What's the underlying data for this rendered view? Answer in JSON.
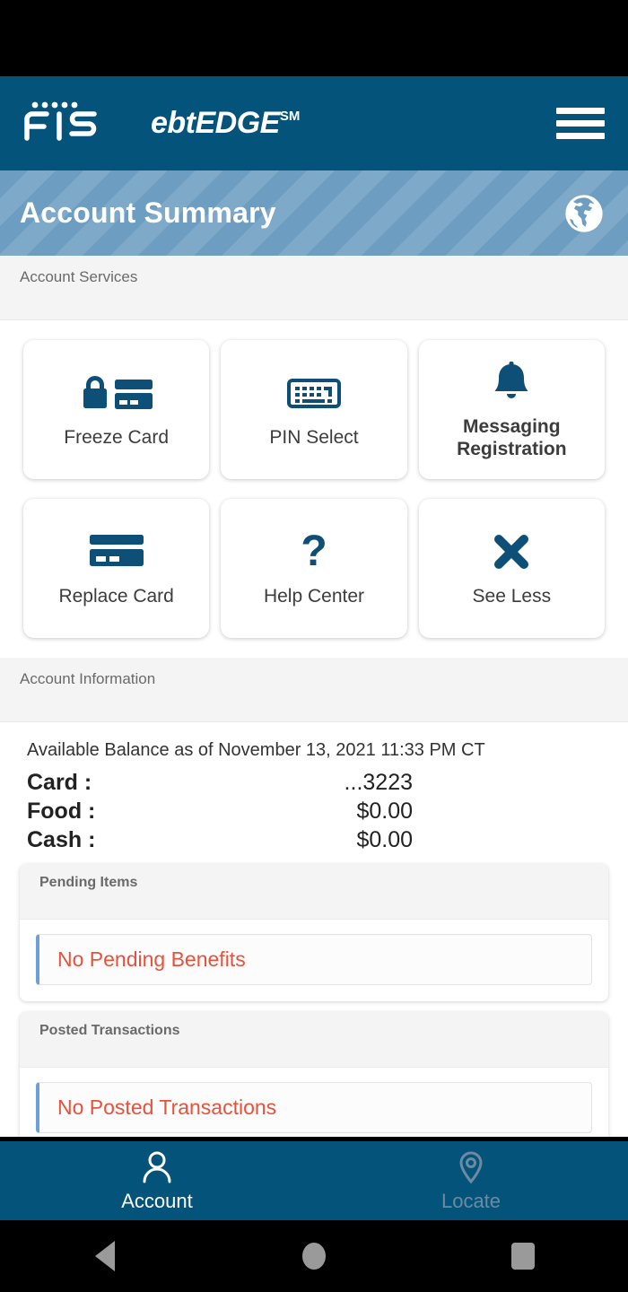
{
  "header": {
    "brand_fis": "FIS",
    "brand_product": "ebtEDGE",
    "brand_sm": "SM",
    "menu_icon": "hamburger-menu-icon"
  },
  "title_bar": {
    "title": "Account Summary",
    "globe_icon": "globe-icon"
  },
  "sections": {
    "account_services_label": "Account Services",
    "account_information_label": "Account Information"
  },
  "tiles": [
    {
      "label": "Freeze Card",
      "icon": "lock-card-icon"
    },
    {
      "label": "PIN Select",
      "icon": "keyboard-icon"
    },
    {
      "label": "Messaging Registration",
      "icon": "bell-icon"
    },
    {
      "label": "Replace Card",
      "icon": "credit-card-icon"
    },
    {
      "label": "Help Center",
      "icon": "question-mark-icon"
    },
    {
      "label": "See Less",
      "icon": "close-x-icon"
    }
  ],
  "account_information": {
    "available_balance_line": "Available Balance as of November 13, 2021 11:33 PM CT",
    "rows": [
      {
        "key": "Card :",
        "value": "...3223"
      },
      {
        "key": "Food :",
        "value": "$0.00"
      },
      {
        "key": "Cash :",
        "value": "$0.00"
      }
    ]
  },
  "pending_items": {
    "title": "Pending Items",
    "message": "No Pending Benefits"
  },
  "posted_transactions": {
    "title": "Posted Transactions",
    "message": "No Posted Transactions"
  },
  "tabbar": [
    {
      "label": "Account",
      "icon": "person-icon",
      "state": "active"
    },
    {
      "label": "Locate",
      "icon": "map-pin-icon",
      "state": "inactive"
    }
  ],
  "android_nav": [
    {
      "icon": "back-triangle-icon"
    },
    {
      "icon": "home-circle-icon"
    },
    {
      "icon": "recents-square-icon"
    }
  ],
  "colors": {
    "brand_blue": "#04537a",
    "title_stripe_light": "#7fa9c8",
    "title_stripe_dark": "#6d9dc0",
    "icon_blue": "#0d4f77",
    "alert_red": "#e8513a",
    "alert_accent": "#6f9fd8",
    "band_gray": "#f4f4f4"
  }
}
